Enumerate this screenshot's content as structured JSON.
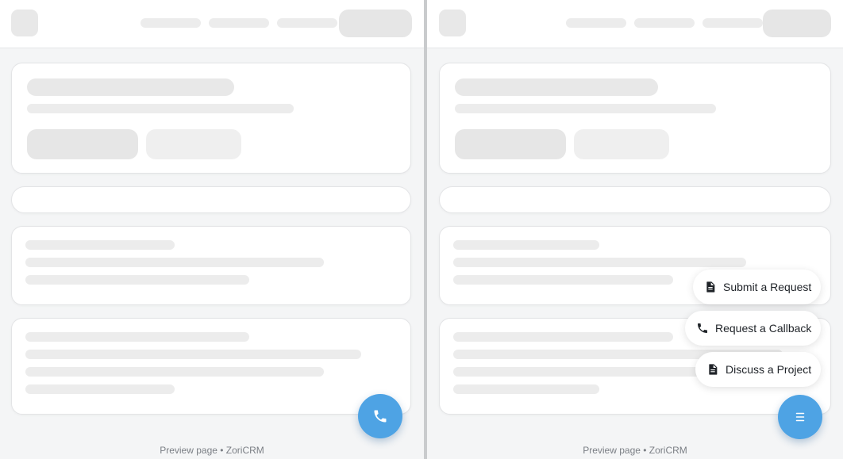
{
  "footer": {
    "left_text": "Preview page • ZoriCRM",
    "right_text": "Preview page • ZoriCRM"
  },
  "fab_left": {
    "icon": "phone-icon",
    "color": "#4ea3e4"
  },
  "fab_right": {
    "icon": "menu-icon",
    "color": "#4ea3e4"
  },
  "actions": [
    {
      "label": "Submit a Request",
      "icon": "document-icon"
    },
    {
      "label": "Request a Callback",
      "icon": "phone-icon"
    },
    {
      "label": "Discuss a Project",
      "icon": "document-icon"
    }
  ]
}
